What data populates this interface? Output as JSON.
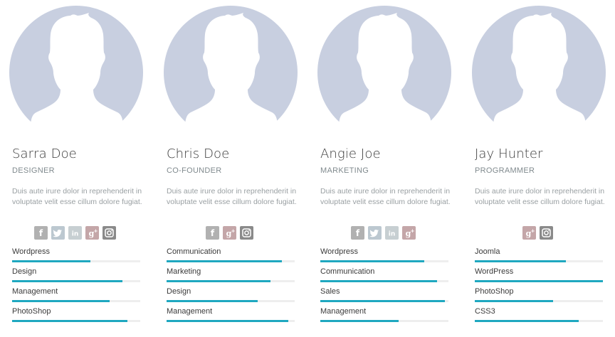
{
  "colors": {
    "avatar_bg": "#c8cfe0",
    "avatar_silhouette": "#ffffff",
    "skill_fill": "#1fa8c0",
    "skill_track": "#eeeeee",
    "facebook": "#b1b1b1",
    "twitter": "#bcc8d0",
    "linkedin": "#c7cfd2",
    "googleplus": "#c4a6a8",
    "instagram": "#8a8a8a"
  },
  "members": [
    {
      "name": "Sarra Doe",
      "role": "DESIGNER",
      "bio": "Duis aute irure dolor in reprehenderit in voluptate velit esse cillum dolore fugiat.",
      "social": [
        "facebook-icon",
        "twitter-icon",
        "linkedin-icon",
        "googleplus-icon",
        "instagram-icon"
      ],
      "skills": [
        {
          "label": "Wordpress",
          "level": 0.61
        },
        {
          "label": "Design",
          "level": 0.86
        },
        {
          "label": "Management",
          "level": 0.76
        },
        {
          "label": "PhotoShop",
          "level": 0.9
        }
      ]
    },
    {
      "name": "Chris Doe",
      "role": "CO-FOUNDER",
      "bio": "Duis aute irure dolor in reprehenderit in voluptate velit esse cillum dolore fugiat.",
      "social": [
        "facebook-icon",
        "googleplus-icon",
        "instagram-icon"
      ],
      "skills": [
        {
          "label": "Communication",
          "level": 0.9
        },
        {
          "label": "Marketing",
          "level": 0.81
        },
        {
          "label": "Design",
          "level": 0.71
        },
        {
          "label": "Management",
          "level": 0.95
        }
      ]
    },
    {
      "name": "Angie Joe",
      "role": "MARKETING",
      "bio": "Duis aute irure dolor in reprehenderit in voluptate velit esse cillum dolore fugiat.",
      "social": [
        "facebook-icon",
        "twitter-icon",
        "linkedin-icon",
        "googleplus-icon"
      ],
      "skills": [
        {
          "label": "Wordpress",
          "level": 0.81
        },
        {
          "label": "Communication",
          "level": 0.91
        },
        {
          "label": "Sales",
          "level": 0.97
        },
        {
          "label": "Management",
          "level": 0.61
        }
      ]
    },
    {
      "name": "Jay Hunter",
      "role": "PROGRAMMER",
      "bio": "Duis aute irure dolor in reprehenderit in voluptate velit esse cillum dolore fugiat.",
      "social": [
        "googleplus-icon",
        "instagram-icon"
      ],
      "skills": [
        {
          "label": "Joomla",
          "level": 0.71
        },
        {
          "label": "WordPress",
          "level": 1.0
        },
        {
          "label": "PhotoShop",
          "level": 0.61
        },
        {
          "label": "CSS3",
          "level": 0.81
        }
      ]
    }
  ]
}
